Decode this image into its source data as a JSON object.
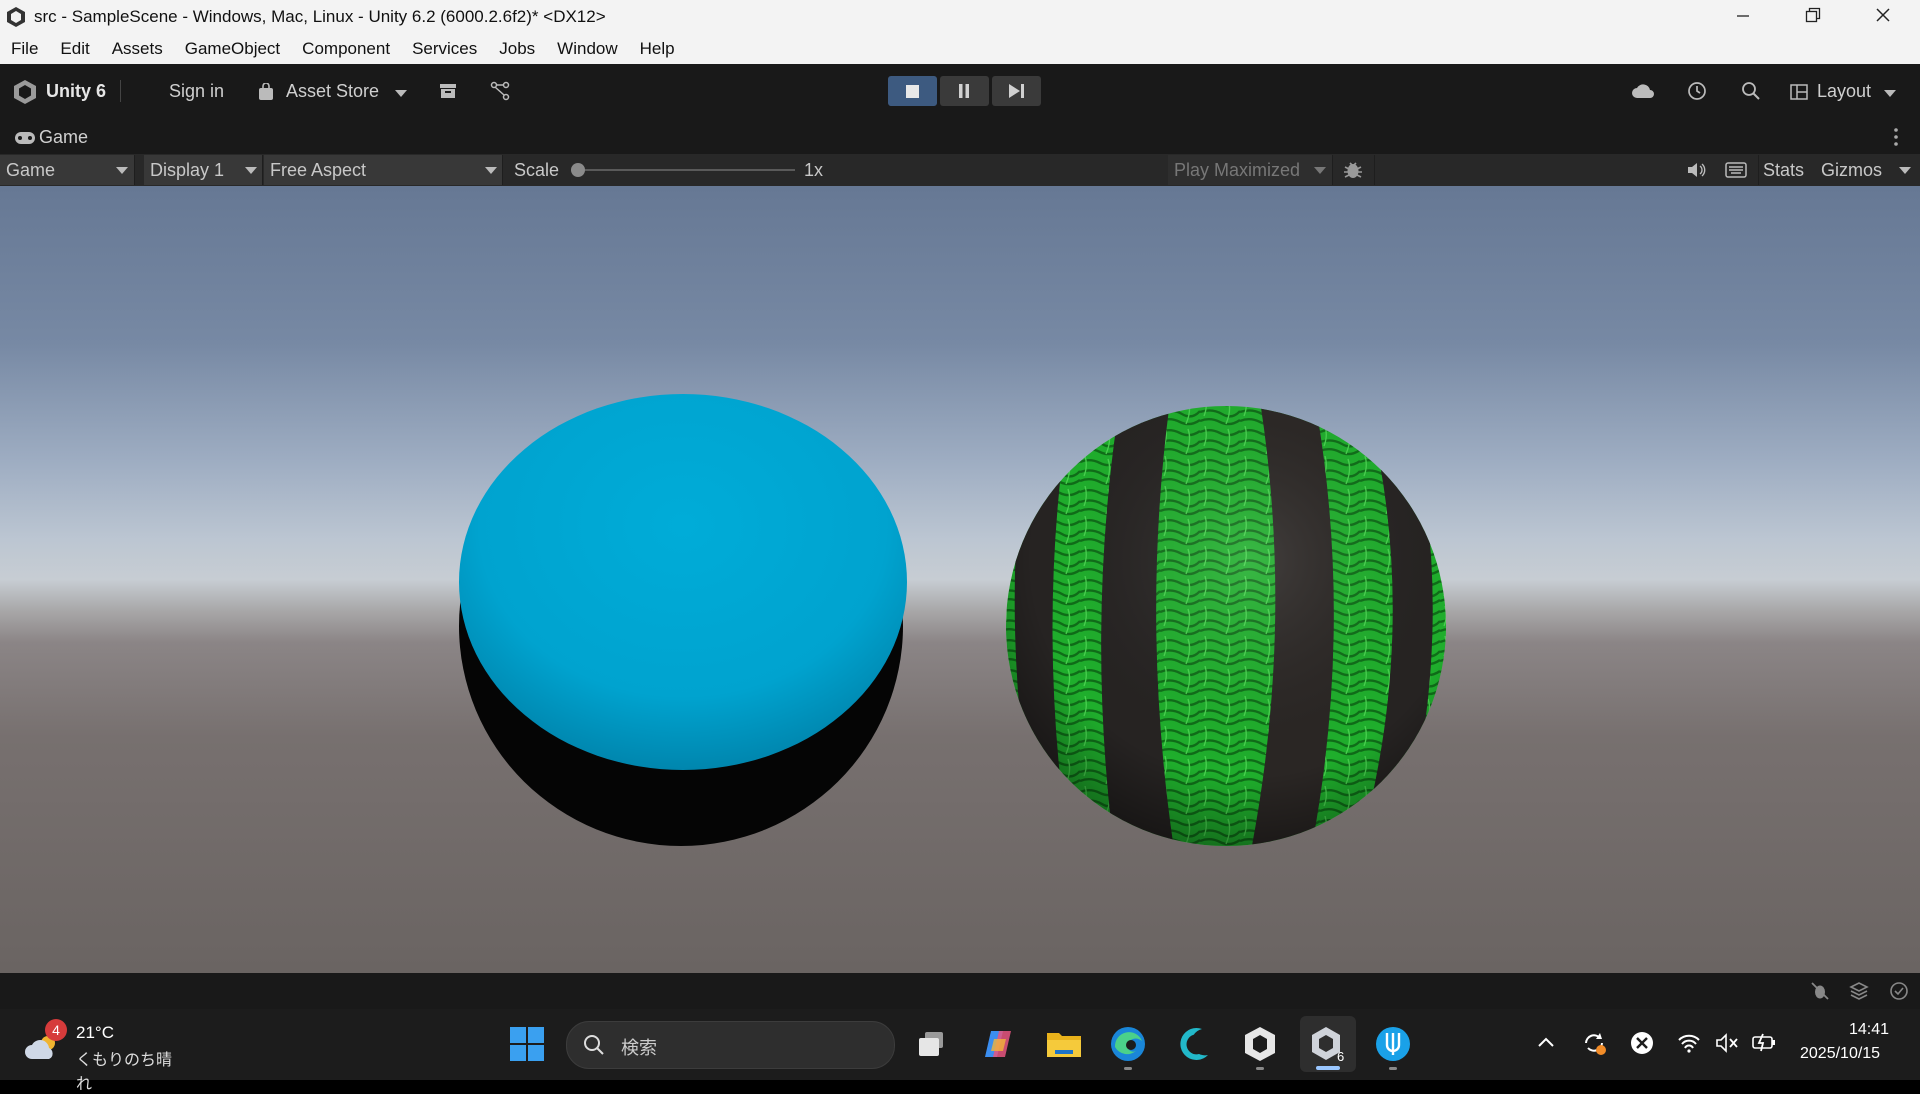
{
  "window": {
    "title": "src - SampleScene - Windows, Mac, Linux - Unity 6.2 (6000.2.6f2)* <DX12>",
    "minimize_icon": "minimize-icon",
    "restore_icon": "restore-icon",
    "close_icon": "close-icon"
  },
  "menu": [
    "File",
    "Edit",
    "Assets",
    "GameObject",
    "Component",
    "Services",
    "Jobs",
    "Window",
    "Help"
  ],
  "toolbar": {
    "brand": "Unity 6",
    "sign_in": "Sign in",
    "asset_store": "Asset Store",
    "layout": "Layout"
  },
  "game_tab": {
    "label": "Game",
    "view_dropdown": "Game",
    "display_dropdown": "Display 1",
    "aspect_dropdown": "Free Aspect",
    "scale_label": "Scale",
    "scale_value": "1x",
    "play_maximized": "Play Maximized",
    "stats": "Stats",
    "gizmos": "Gizmos"
  },
  "scene": {
    "sky_top_color": "#667894",
    "ground_color": "#6a6462",
    "sphere1_color": "#00a9d4",
    "sphere2_stripe_green": "#1fae2c",
    "sphere2_stripe_dark": "#262322"
  },
  "taskbar": {
    "weather_badge": "4",
    "temperature": "21°C",
    "weather_text": "くもりのち晴れ",
    "search_placeholder": "検索",
    "time": "14:41",
    "date": "2025/10/15"
  }
}
